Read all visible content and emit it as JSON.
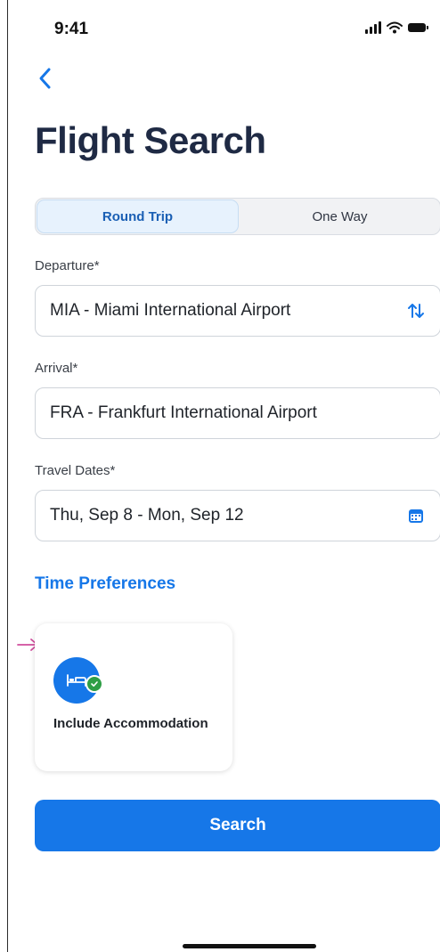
{
  "status_bar": {
    "time": "9:41"
  },
  "page": {
    "title": "Flight Search"
  },
  "trip_type": {
    "options": [
      "Round Trip",
      "One Way"
    ],
    "selected": "Round Trip"
  },
  "departure": {
    "label": "Departure*",
    "value": "MIA - Miami International Airport"
  },
  "arrival": {
    "label": "Arrival*",
    "value": "FRA - Frankfurt International Airport"
  },
  "travel_dates": {
    "label": "Travel Dates*",
    "value": "Thu, Sep 8 - Mon, Sep 12"
  },
  "time_preferences": {
    "label": "Time Preferences"
  },
  "accommodation_card": {
    "label": "Include Accommodation",
    "icon": "bed-icon",
    "selected": true
  },
  "search": {
    "label": "Search"
  },
  "colors": {
    "accent": "#1677e8",
    "title": "#1f2a44",
    "check": "#2e9e45",
    "arrow": "#d04c9c"
  }
}
